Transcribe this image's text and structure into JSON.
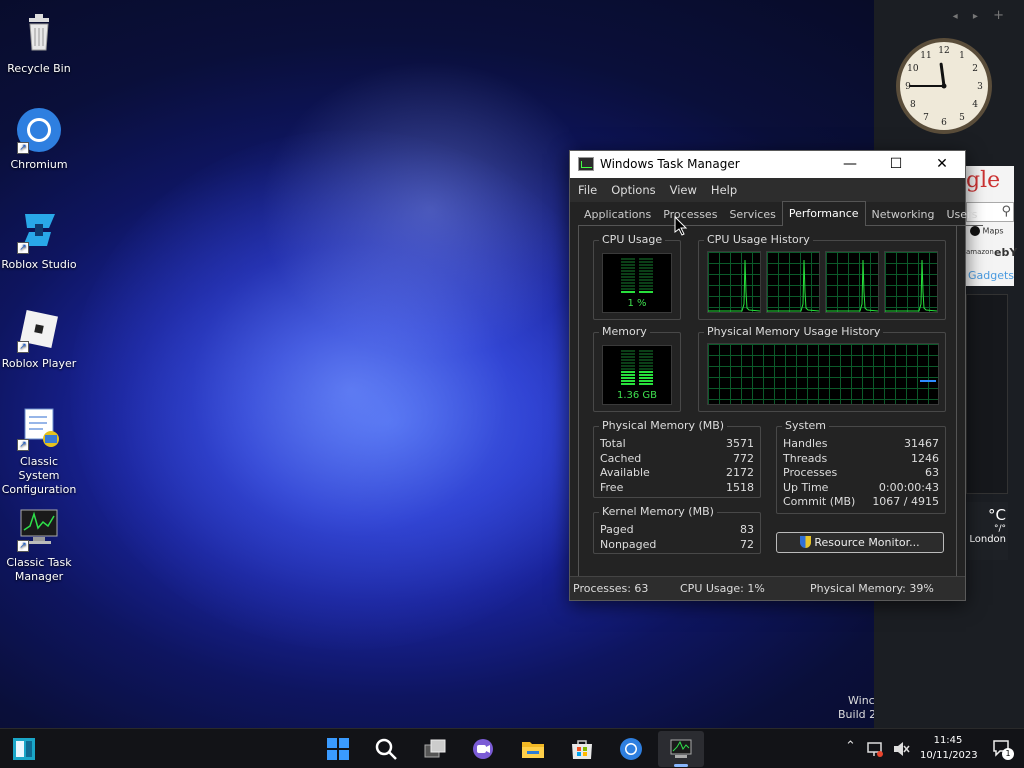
{
  "desktop": {
    "icons": [
      {
        "label": "Recycle Bin"
      },
      {
        "label": "Chromium"
      },
      {
        "label": "Roblox Studio"
      },
      {
        "label": "Roblox Player"
      },
      {
        "label": "Classic System Configuration"
      },
      {
        "label": "Classic Task Manager"
      }
    ],
    "watermark": {
      "line1": "Winc",
      "line2": "Build 2"
    }
  },
  "sidebar": {
    "nav_prev": "◂",
    "nav_next": "▸",
    "nav_add": "+",
    "clock": {
      "hour": 11,
      "minute": 45
    },
    "search_gadget": {
      "logo": "gle",
      "maps": "Maps",
      "amazon": "amazon",
      "ebay": "ebY",
      "footer": "Gadgets"
    },
    "weather": {
      "temp": "°C",
      "range": "°/°",
      "city": "London"
    }
  },
  "task_manager": {
    "title": "Windows Task Manager",
    "menu": [
      "File",
      "Options",
      "View",
      "Help"
    ],
    "tabs": [
      "Applications",
      "Processes",
      "Services",
      "Performance",
      "Networking",
      "Users"
    ],
    "active_tab": "Performance",
    "cpu_usage": {
      "label": "CPU Usage",
      "value": "1 %",
      "percent": 1
    },
    "cpu_history": {
      "label": "CPU Usage History",
      "cores": 4
    },
    "memory": {
      "label": "Memory",
      "value": "1.36 GB",
      "percent": 39
    },
    "memory_history": {
      "label": "Physical Memory Usage History"
    },
    "physical_memory": {
      "label": "Physical Memory (MB)",
      "rows": [
        {
          "k": "Total",
          "v": "3571"
        },
        {
          "k": "Cached",
          "v": "772"
        },
        {
          "k": "Available",
          "v": "2172"
        },
        {
          "k": "Free",
          "v": "1518"
        }
      ]
    },
    "system": {
      "label": "System",
      "rows": [
        {
          "k": "Handles",
          "v": "31467"
        },
        {
          "k": "Threads",
          "v": "1246"
        },
        {
          "k": "Processes",
          "v": "63"
        },
        {
          "k": "Up Time",
          "v": "0:00:00:43"
        },
        {
          "k": "Commit (MB)",
          "v": "1067 / 4915"
        }
      ]
    },
    "kernel_memory": {
      "label": "Kernel Memory (MB)",
      "rows": [
        {
          "k": "Paged",
          "v": "83"
        },
        {
          "k": "Nonpaged",
          "v": "72"
        }
      ]
    },
    "resource_monitor_label": "Resource Monitor...",
    "status": {
      "processes": "Processes: 63",
      "cpu": "CPU Usage: 1%",
      "memory": "Physical Memory: 39%"
    }
  },
  "taskbar": {
    "time": "11:45",
    "date": "10/11/2023",
    "notification_count": "1"
  },
  "colors": {
    "accent": "#2d7cd6",
    "graph_green": "#28e03c",
    "graph_grid": "#0b5a2a"
  }
}
